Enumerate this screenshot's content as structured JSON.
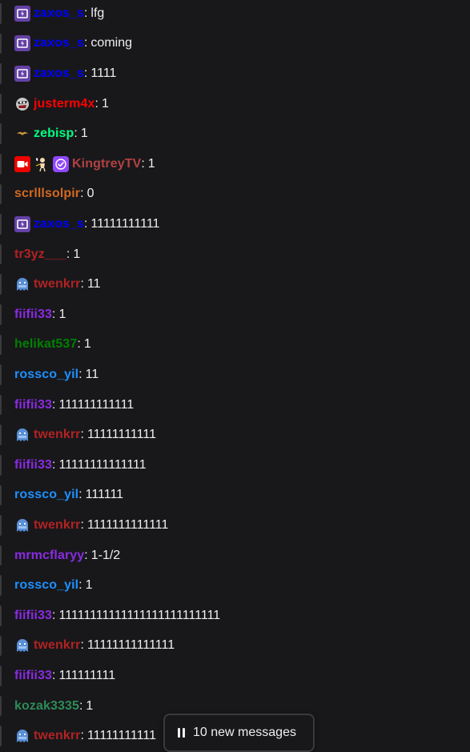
{
  "messages": [
    {
      "badges": [
        "prime-icon"
      ],
      "user": "zaxos_s",
      "color": "#0000ff",
      "text": "lfg"
    },
    {
      "badges": [
        "prime-icon"
      ],
      "user": "zaxos_s",
      "color": "#0000ff",
      "text": "coming"
    },
    {
      "badges": [
        "prime-icon"
      ],
      "user": "zaxos_s",
      "color": "#0000ff",
      "text": "1111"
    },
    {
      "badges": [
        "custom-creature-icon"
      ],
      "user": "justerm4x",
      "color": "#ff0000",
      "text": "1"
    },
    {
      "badges": [
        "bird-icon"
      ],
      "user": "zebisp",
      "color": "#00ff7f",
      "text": "1"
    },
    {
      "badges": [
        "video-camera-icon",
        "cupid-icon",
        "verified-icon"
      ],
      "user": "KingtreyTV",
      "color": "#b24141",
      "text": "1"
    },
    {
      "badges": [],
      "user": "scrlllsolpir",
      "color": "#d2691e",
      "text": "0"
    },
    {
      "badges": [
        "prime-icon"
      ],
      "user": "zaxos_s",
      "color": "#0000ff",
      "text": "11111111111"
    },
    {
      "badges": [],
      "user": "tr3yz___",
      "color": "#b22222",
      "text": "1"
    },
    {
      "badges": [
        "ghost-icon"
      ],
      "user": "twenkrr",
      "color": "#b22222",
      "text": "11"
    },
    {
      "badges": [],
      "user": "fiifii33",
      "color": "#8a2be2",
      "text": "1"
    },
    {
      "badges": [],
      "user": "helikat537",
      "color": "#008000",
      "text": "1"
    },
    {
      "badges": [],
      "user": "rossco_yil",
      "color": "#1e90ff",
      "text": "11"
    },
    {
      "badges": [],
      "user": "fiifii33",
      "color": "#8a2be2",
      "text": "111111111111"
    },
    {
      "badges": [
        "ghost-icon"
      ],
      "user": "twenkrr",
      "color": "#b22222",
      "text": "11111111111"
    },
    {
      "badges": [],
      "user": "fiifii33",
      "color": "#8a2be2",
      "text": "11111111111111"
    },
    {
      "badges": [],
      "user": "rossco_yil",
      "color": "#1e90ff",
      "text": "111111"
    },
    {
      "badges": [
        "ghost-icon"
      ],
      "user": "twenkrr",
      "color": "#b22222",
      "text": "1111111111111"
    },
    {
      "badges": [],
      "user": "mrmcflaryy",
      "color": "#8a2be2",
      "text": "1-1/2"
    },
    {
      "badges": [],
      "user": "rossco_yil",
      "color": "#1e90ff",
      "text": "1"
    },
    {
      "badges": [],
      "user": "fiifii33",
      "color": "#8a2be2",
      "text": "11111111111111111111111111"
    },
    {
      "badges": [
        "ghost-icon"
      ],
      "user": "twenkrr",
      "color": "#b22222",
      "text": "11111111111111"
    },
    {
      "badges": [],
      "user": "fiifii33",
      "color": "#8a2be2",
      "text": "111111111"
    },
    {
      "badges": [],
      "user": "kozak3335",
      "color": "#2e8b57",
      "text": "1"
    },
    {
      "badges": [
        "ghost-icon"
      ],
      "user": "twenkrr",
      "color": "#b22222",
      "text": "11111111111"
    }
  ],
  "new_messages_banner": {
    "label": "10 new messages",
    "icon": "pause-icon"
  },
  "colors": {
    "background": "#18181b",
    "text": "#efeff1",
    "divider": "#3a3a3d"
  }
}
